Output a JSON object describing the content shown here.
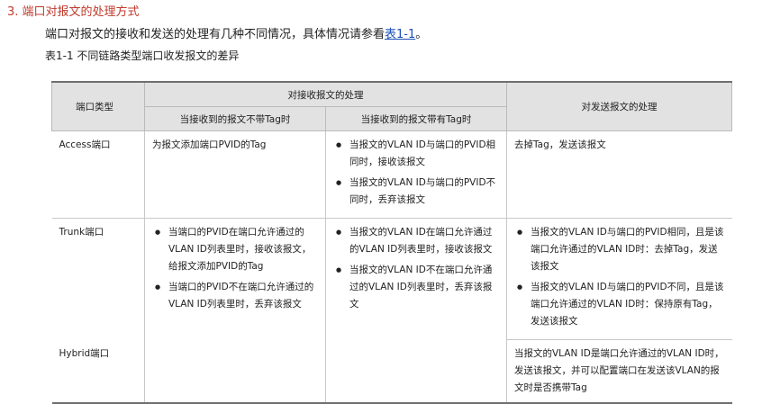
{
  "section": {
    "title": "3. 端口对报文的处理方式",
    "intro_text": "端口对报文的接收和发送的处理有几种不同情况，具体情况请参看",
    "intro_link": "表1-1",
    "intro_end": "。",
    "caption": "表1-1 不同链路类型端口收发报文的差异"
  },
  "table": {
    "headers": {
      "port_type": "端口类型",
      "receive": "对接收报文的处理",
      "send": "对发送报文的处理",
      "untagged": "当接收到的报文不带Tag时",
      "tagged": "当接收到的报文带有Tag时"
    },
    "rows": {
      "access": {
        "name": "Access端口",
        "untagged": "为报文添加端口PVID的Tag",
        "tagged": [
          "当报文的VLAN ID与端口的PVID相同时，接收该报文",
          "当报文的VLAN ID与端口的PVID不同时，丢弃该报文"
        ],
        "send": "去掉Tag，发送该报文"
      },
      "trunk": {
        "name": "Trunk端口",
        "untagged": [
          "当端口的PVID在端口允许通过的VLAN ID列表里时，接收该报文，给报文添加PVID的Tag",
          "当端口的PVID不在端口允许通过的VLAN ID列表里时，丢弃该报文"
        ],
        "tagged": [
          "当报文的VLAN ID在端口允许通过的VLAN ID列表里时，接收该报文",
          "当报文的VLAN ID不在端口允许通过的VLAN ID列表里时，丢弃该报文"
        ],
        "send": [
          "当报文的VLAN ID与端口的PVID相同，且是该端口允许通过的VLAN ID时：去掉Tag，发送该报文",
          "当报文的VLAN ID与端口的PVID不同，且是该端口允许通过的VLAN ID时：保持原有Tag，发送该报文"
        ]
      },
      "hybrid": {
        "name": "Hybrid端口",
        "send": "当报文的VLAN ID是端口允许通过的VLAN ID时，发送该报文，并可以配置端口在发送该VLAN的报文时是否携带Tag"
      }
    }
  }
}
